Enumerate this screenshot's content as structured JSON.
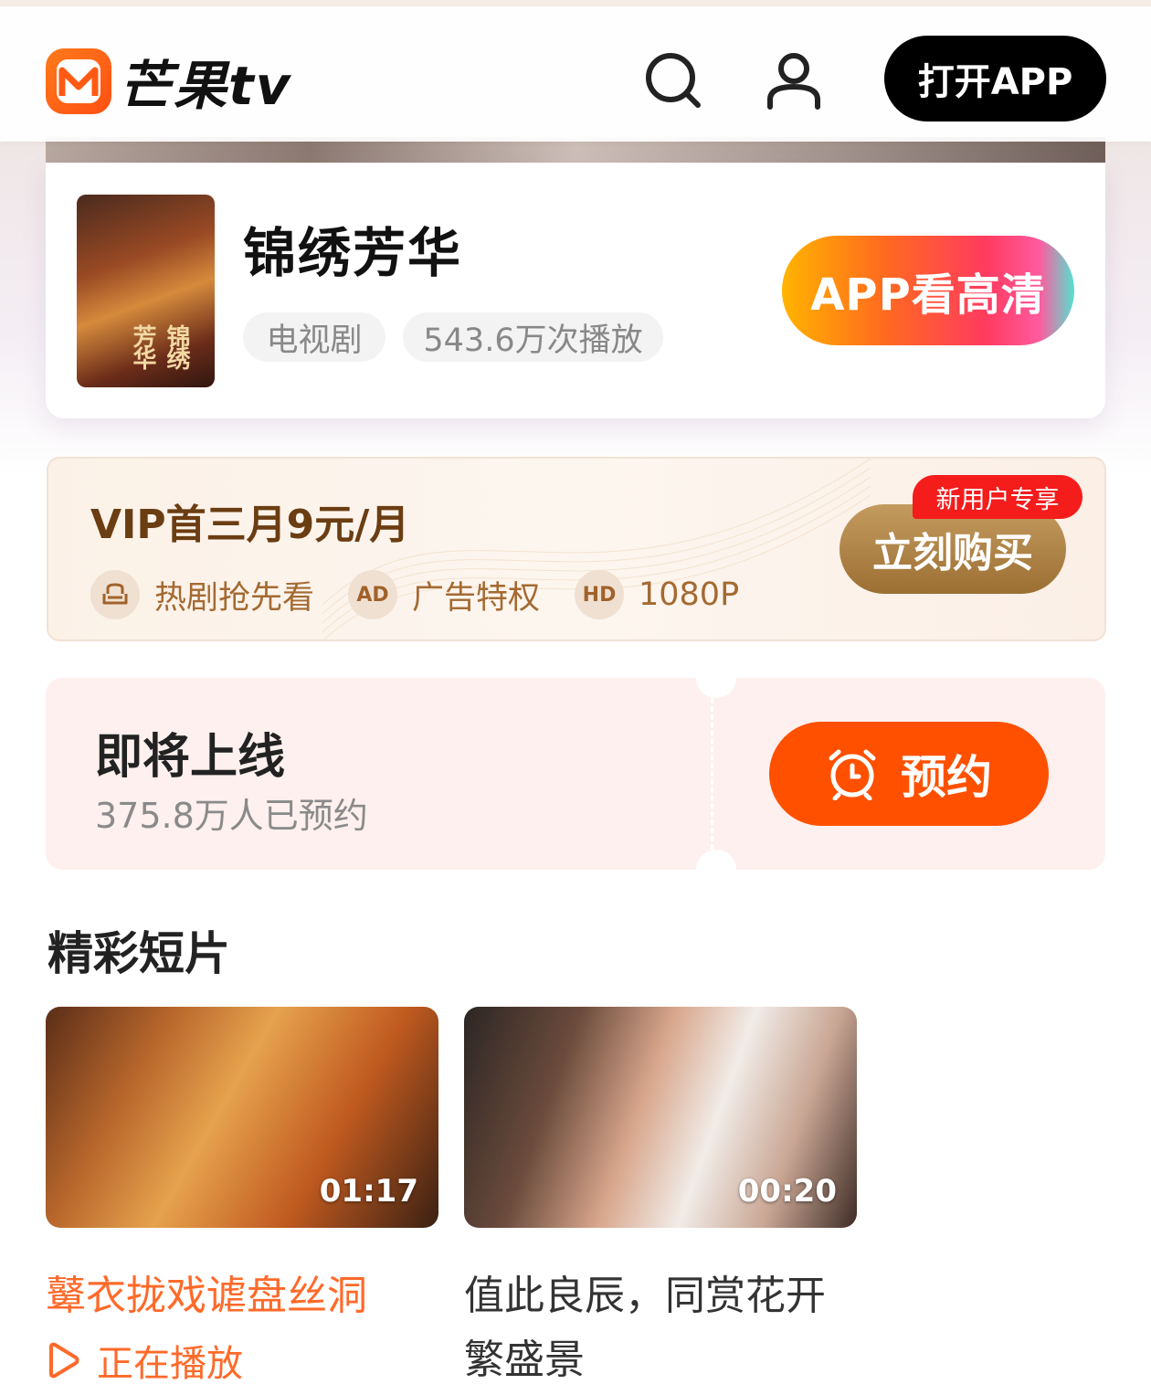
{
  "header": {
    "logo_text": "芒果tv",
    "open_app_label": "打开APP",
    "icons": [
      "search-icon",
      "user-icon"
    ]
  },
  "show": {
    "poster_text": "锦绣芳华",
    "title": "锦绣芳华",
    "genre": "电视剧",
    "plays": "543.6万次播放",
    "hd_button": "APP看高清"
  },
  "vip": {
    "title": "VIP首三月9元/月",
    "badge": "新用户专享",
    "buy_label": "立刻购买",
    "perks": [
      {
        "icon": "sofa-icon",
        "label": "热剧抢先看"
      },
      {
        "icon": "AD",
        "label": "广告特权"
      },
      {
        "icon": "HD",
        "label": "1080P"
      }
    ]
  },
  "upcoming": {
    "title": "即将上线",
    "subtitle": "375.8万人已预约",
    "reserve_label": "预约"
  },
  "clips": {
    "section_title": "精彩短片",
    "items": [
      {
        "title": "鼙衣拢戏谑盘丝洞",
        "duration": "01:17",
        "status": "正在播放"
      },
      {
        "title_line1": "值此良辰，同赏花开",
        "title_line2": "繁盛景",
        "duration": "00:20"
      }
    ]
  },
  "colors": {
    "brand_orange": "#ff5000",
    "vip_brown": "#6b3d12",
    "badge_red": "#f51c1c"
  }
}
